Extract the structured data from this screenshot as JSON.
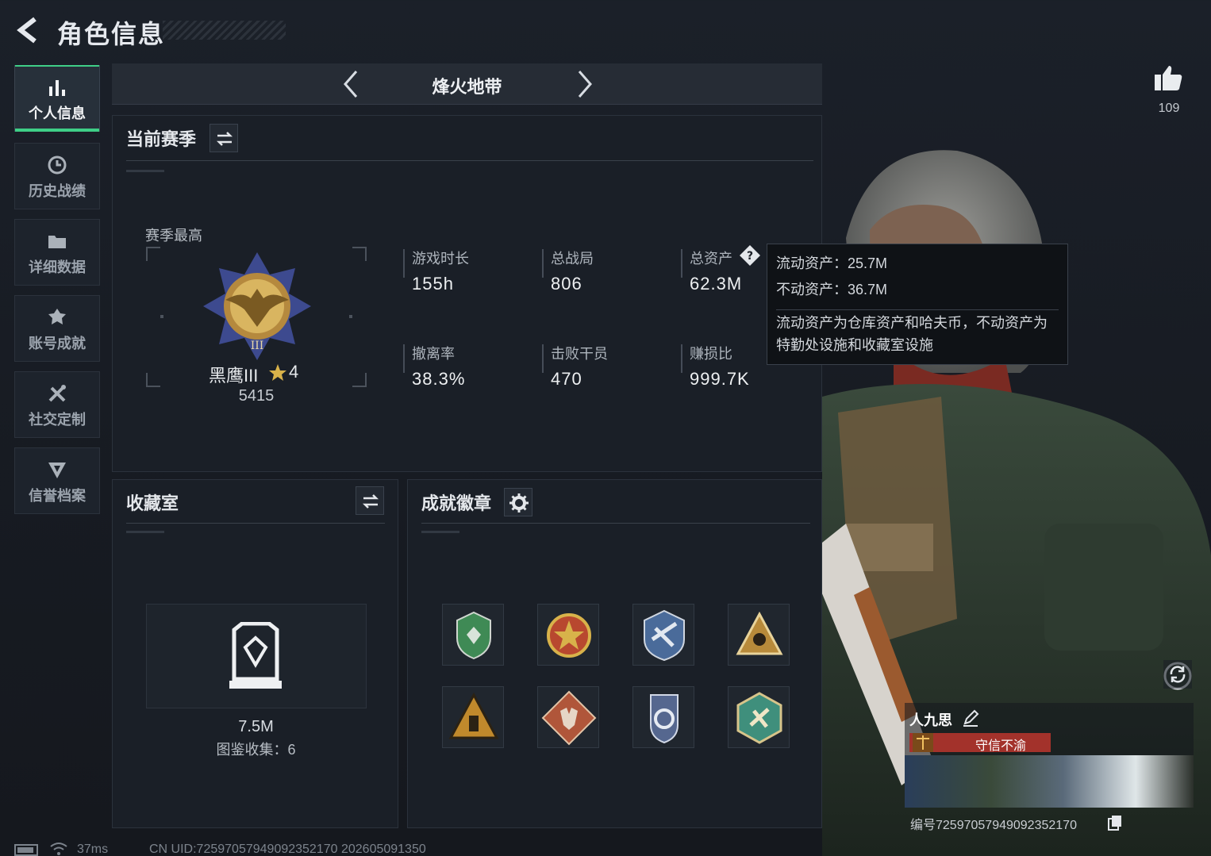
{
  "header": {
    "title": "角色信息"
  },
  "sidebar": {
    "items": [
      {
        "label": "个人信息",
        "icon": "bar-chart-icon",
        "active": true
      },
      {
        "label": "历史战绩",
        "icon": "history-clock-icon",
        "active": false
      },
      {
        "label": "详细数据",
        "icon": "folder-icon",
        "active": false
      },
      {
        "label": "账号成就",
        "icon": "achievement-medal-icon",
        "active": false
      },
      {
        "label": "社交定制",
        "icon": "tools-icon",
        "active": false
      },
      {
        "label": "信誉档案",
        "icon": "reputation-shield-icon",
        "active": false
      }
    ]
  },
  "mode_bar": {
    "title": "烽火地带"
  },
  "likes": {
    "count": "109"
  },
  "season": {
    "title": "当前赛季",
    "best_label": "赛季最高",
    "rank_name": "黑鹰III",
    "rank_stars": "4",
    "rank_score": "5415",
    "stats": [
      {
        "label": "游戏时长",
        "value": "155h"
      },
      {
        "label": "总战局",
        "value": "806"
      },
      {
        "label": "总资产",
        "value": "62.3M"
      },
      {
        "label": "撤离率",
        "value": "38.3%"
      },
      {
        "label": "击败干员",
        "value": "470"
      },
      {
        "label": "赚损比",
        "value": "999.7K"
      }
    ]
  },
  "tooltip": {
    "liquid": "流动资产：25.7M",
    "fixed": "不动资产：36.7M",
    "desc_line1": "流动资产为仓库资产和哈夫币，不动资产为",
    "desc_line2": "特勤处设施和收藏室设施"
  },
  "collection": {
    "title": "收藏室",
    "value": "7.5M",
    "count_label": "图鉴收集：6"
  },
  "achievements": {
    "title": "成就徽章",
    "badges": [
      {
        "name": "green-shield-badge",
        "color": "#3f8a55"
      },
      {
        "name": "red-star-badge",
        "color": "#b8482f"
      },
      {
        "name": "blue-wings-badge",
        "color": "#4a6b9a"
      },
      {
        "name": "gold-triangle-badge",
        "color": "#b88a3a"
      },
      {
        "name": "amber-pyramid-badge",
        "color": "#c0892c"
      },
      {
        "name": "wolf-diamond-badge",
        "color": "#b0563a"
      },
      {
        "name": "blue-crest-badge",
        "color": "#55678f"
      },
      {
        "name": "teal-hex-badge",
        "color": "#3f8f7c"
      }
    ]
  },
  "character": {
    "name": "人九思",
    "honor": "守信不渝",
    "id_line": "编号7259705794909235217​0"
  },
  "status": {
    "ping": "37ms",
    "uid_line": "CN UID:7259705794909235217​0 202605091350"
  }
}
